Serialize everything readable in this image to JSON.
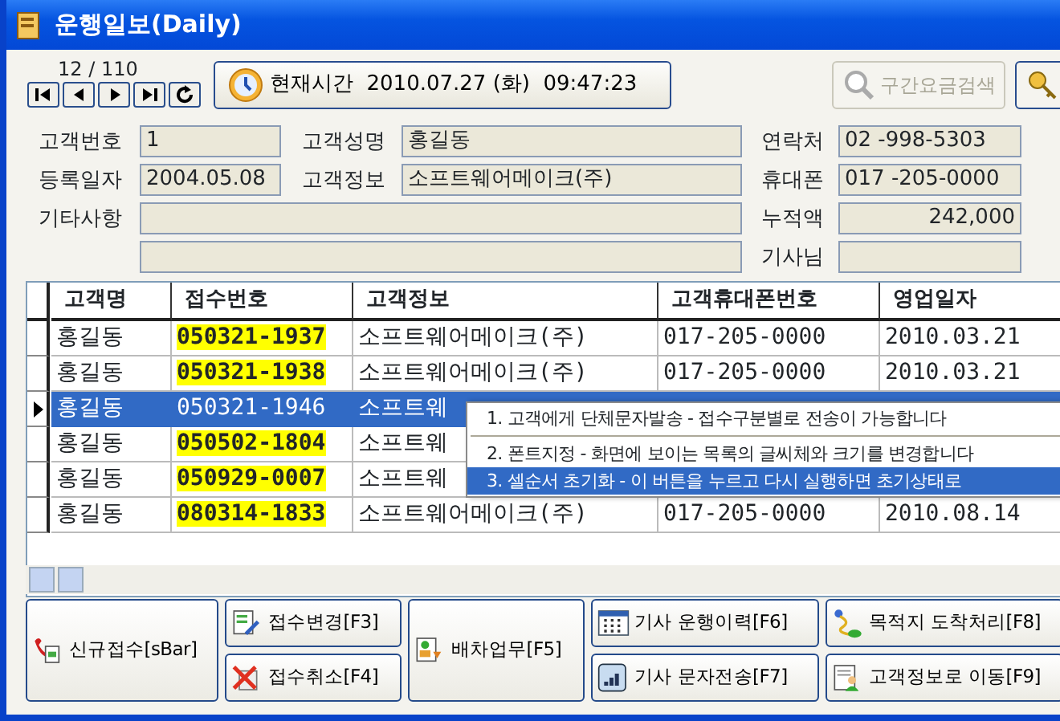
{
  "window": {
    "title": "운행일보(Daily)"
  },
  "navigator": {
    "position": "12 / 110",
    "buttons": [
      {
        "kind": "first"
      },
      {
        "kind": "prev"
      },
      {
        "kind": "next"
      },
      {
        "kind": "last"
      },
      {
        "kind": "refresh"
      }
    ]
  },
  "clock_button": {
    "label": "현재시간",
    "date": "2010.07.27 (화)",
    "time": "09:47:23"
  },
  "toolbar": [
    {
      "kind": "search",
      "label": "구간요금검색",
      "disabled": true
    },
    {
      "kind": "key",
      "disabled": false
    }
  ],
  "form": {
    "rows": [
      [
        {
          "label": "고객번호",
          "value": "1"
        },
        {
          "label": "고객성명",
          "value": "홍길동"
        },
        {
          "label": "연락처",
          "value": "02   -998-5303"
        }
      ],
      [
        {
          "label": "등록일자",
          "value": "2004.05.08"
        },
        {
          "label": "고객정보",
          "value": "소프트웨어메이크(주)"
        },
        {
          "label": "휴대폰",
          "value": "017 -205-0000"
        }
      ],
      [
        {
          "label": "기타사항",
          "kind": "memo"
        },
        {
          "label": "누적액",
          "value": "242,000",
          "kind": "amount"
        }
      ],
      [
        {
          "kind": "memo"
        },
        {
          "label": "기사님"
        }
      ]
    ]
  },
  "grid": {
    "columns": [
      "고객명",
      "접수번호",
      "고객정보",
      "고객휴대폰번호",
      "영업일자"
    ],
    "rows": [
      {
        "selected": false,
        "cells": [
          "홍길동",
          "050321-1937",
          "소프트웨어메이크(주)",
          "017-205-0000",
          "2010.03.21"
        ]
      },
      {
        "selected": false,
        "cells": [
          "홍길동",
          "050321-1938",
          "소프트웨어메이크(주)",
          "017-205-0000",
          "2010.03.21"
        ]
      },
      {
        "selected": true,
        "cells": [
          "홍길동",
          "050321-1946",
          "소프트웨"
        ]
      },
      {
        "selected": false,
        "cells": [
          "홍길동",
          "050502-1804",
          "소프트웨"
        ]
      },
      {
        "selected": false,
        "cells": [
          "홍길동",
          "050929-0007",
          "소프트웨"
        ]
      },
      {
        "selected": false,
        "cells": [
          "홍길동",
          "080314-1833",
          "소프트웨어메이크(주)",
          "017-205-0000",
          "2010.08.14"
        ]
      }
    ]
  },
  "context_menu": {
    "items": [
      {
        "text": "1. 고객에게 단체문자발송 - 접수구분별로 전송이 가능합니다",
        "selected": false,
        "separator_after": true
      },
      {
        "text": "2. 폰트지정 - 화면에 보이는  목록의 글씨체와 크기를 변경합니다",
        "selected": false,
        "separator_after": false
      },
      {
        "text": "3. 셀순서 초기화 - 이 버튼을 누르고 다시 실행하면 초기상태로",
        "selected": true,
        "separator_after": false
      }
    ]
  },
  "actions": [
    [
      {
        "kind": "phone",
        "label": "신규접수[sBar]"
      }
    ],
    [
      {
        "kind": "edit",
        "label": "접수변경[F3]"
      },
      {
        "kind": "cancel",
        "label": "접수취소[F4]"
      }
    ],
    [
      {
        "kind": "dispatch",
        "label": "배차업무[F5]"
      }
    ],
    [
      {
        "kind": "calendar",
        "label": "기사 운행이력[F6]"
      },
      {
        "kind": "signal",
        "label": "기사 문자전송[F7]"
      }
    ],
    [
      {
        "kind": "route",
        "label": "목적지 도착처리[F8]"
      },
      {
        "kind": "customer",
        "label": "고객정보로 이동[F9]"
      }
    ]
  ]
}
